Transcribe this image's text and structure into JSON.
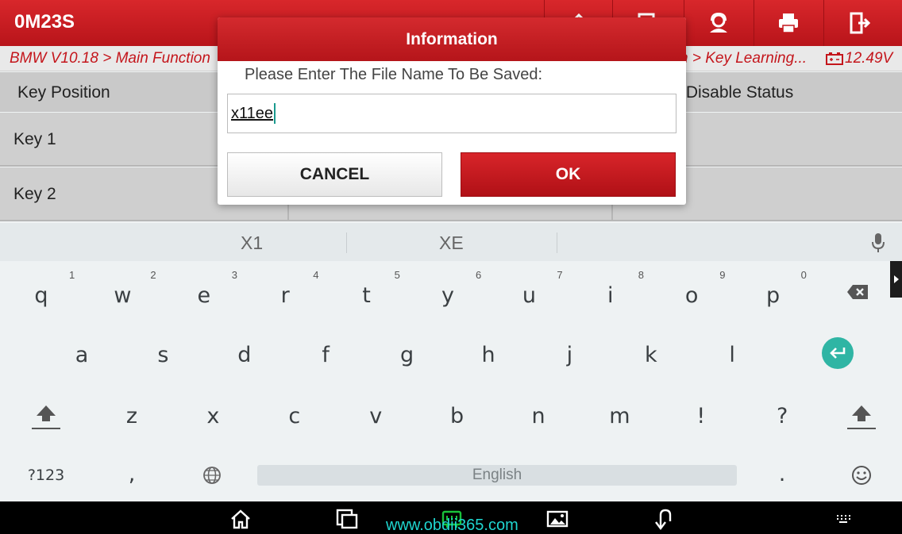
{
  "header": {
    "app_title": "0M23S",
    "breadcrumb_left": "BMW V10.18 > Main Function",
    "breadcrumb_right": "n > Key Learning...",
    "battery_voltage": "12.49V",
    "icons": [
      "home-icon",
      "report-icon",
      "support-icon",
      "print-icon",
      "exit-icon"
    ]
  },
  "table": {
    "columns": [
      "Key Position",
      "/Disable Status"
    ],
    "rows": [
      {
        "label": "Key 1"
      },
      {
        "label": "Key 2"
      }
    ]
  },
  "dialog": {
    "title": "Information",
    "prompt": "Please Enter The File Name To Be Saved:",
    "input_value": "x11ee",
    "cancel_label": "CANCEL",
    "ok_label": "OK"
  },
  "keyboard": {
    "suggestions": [
      "X1",
      "XE"
    ],
    "row1": [
      {
        "k": "q",
        "h": "1"
      },
      {
        "k": "w",
        "h": "2"
      },
      {
        "k": "e",
        "h": "3"
      },
      {
        "k": "r",
        "h": "4"
      },
      {
        "k": "t",
        "h": "5"
      },
      {
        "k": "y",
        "h": "6"
      },
      {
        "k": "u",
        "h": "7"
      },
      {
        "k": "i",
        "h": "8"
      },
      {
        "k": "o",
        "h": "9"
      },
      {
        "k": "p",
        "h": "0"
      }
    ],
    "row2": [
      "a",
      "s",
      "d",
      "f",
      "g",
      "h",
      "j",
      "k",
      "l"
    ],
    "row3": [
      "z",
      "x",
      "c",
      "v",
      "b",
      "n",
      "m",
      "!",
      "?"
    ],
    "symbols_label": "?123",
    "comma": ",",
    "period": ".",
    "space_label": "English"
  },
  "watermark": "www.obdii365.com",
  "colors": {
    "brand_red": "#c4161c",
    "accent_teal": "#2fb5a4",
    "watermark_cyan": "#1fd6d0"
  }
}
